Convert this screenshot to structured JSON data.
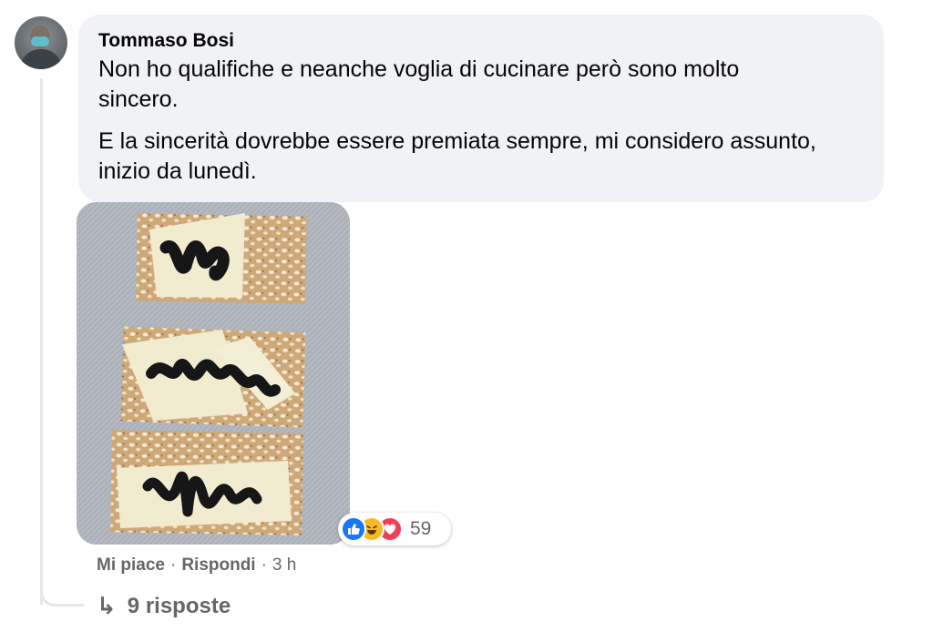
{
  "comment": {
    "author": "Tommaso Bosi",
    "paragraphs": [
      "Non ho qualifiche e neanche voglia di cucinare però sono molto sincero.",
      "E la sincerità dovrebbe essere premiata sempre, mi considero assunto, inizio da lunedì."
    ]
  },
  "reactions": {
    "icons": [
      "like-icon",
      "haha-icon",
      "love-icon"
    ],
    "count": "59"
  },
  "actions": {
    "like_label": "Mi piace",
    "reply_label": "Rispondi",
    "separator": "·",
    "time": "3 h"
  },
  "replies": {
    "label": "9 risposte",
    "arrow": "↳"
  },
  "colors": {
    "bubble": "#f0f2f5",
    "secondary_text": "#65676b",
    "like": "#1877f2",
    "love": "#f33e58",
    "haha": "#f7b928"
  }
}
